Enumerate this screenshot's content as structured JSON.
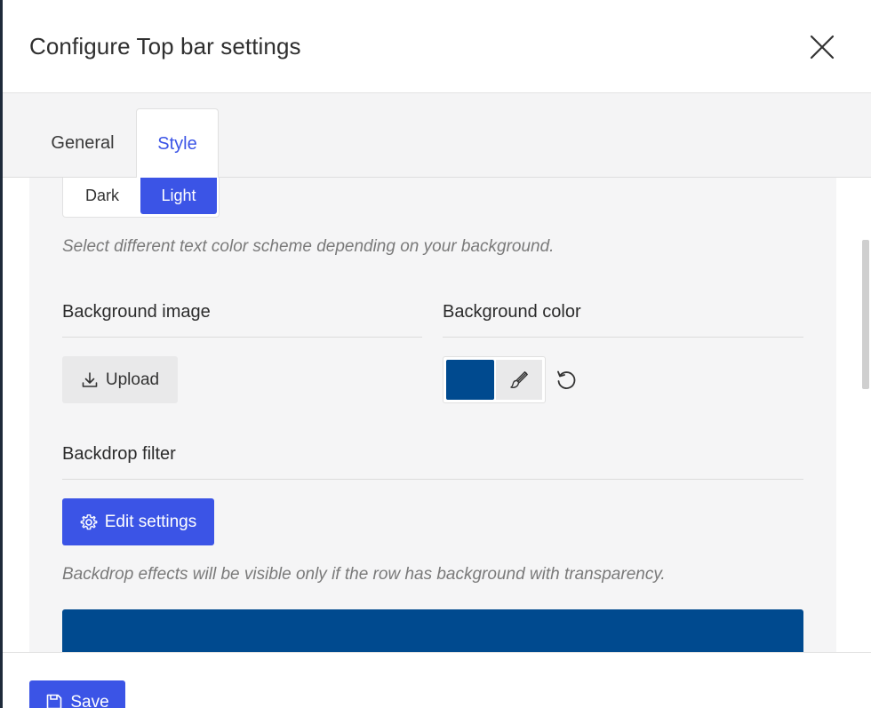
{
  "dialog": {
    "title": "Configure Top bar settings"
  },
  "tabs": [
    {
      "label": "General",
      "active": false
    },
    {
      "label": "Style",
      "active": true
    }
  ],
  "text_scheme": {
    "options": [
      "Dark",
      "Light"
    ],
    "selected": "Light",
    "hint": "Select different text color scheme depending on your background."
  },
  "background_image": {
    "label": "Background image",
    "upload_label": "Upload"
  },
  "background_color": {
    "label": "Background color",
    "value": "#004a8f"
  },
  "backdrop_filter": {
    "label": "Backdrop filter",
    "edit_label": "Edit settings",
    "hint": "Backdrop effects will be visible only if the row has background with transparency."
  },
  "footer": {
    "save_label": "Save"
  },
  "colors": {
    "accent": "#3b54e6",
    "preview_background": "#004a8f"
  }
}
